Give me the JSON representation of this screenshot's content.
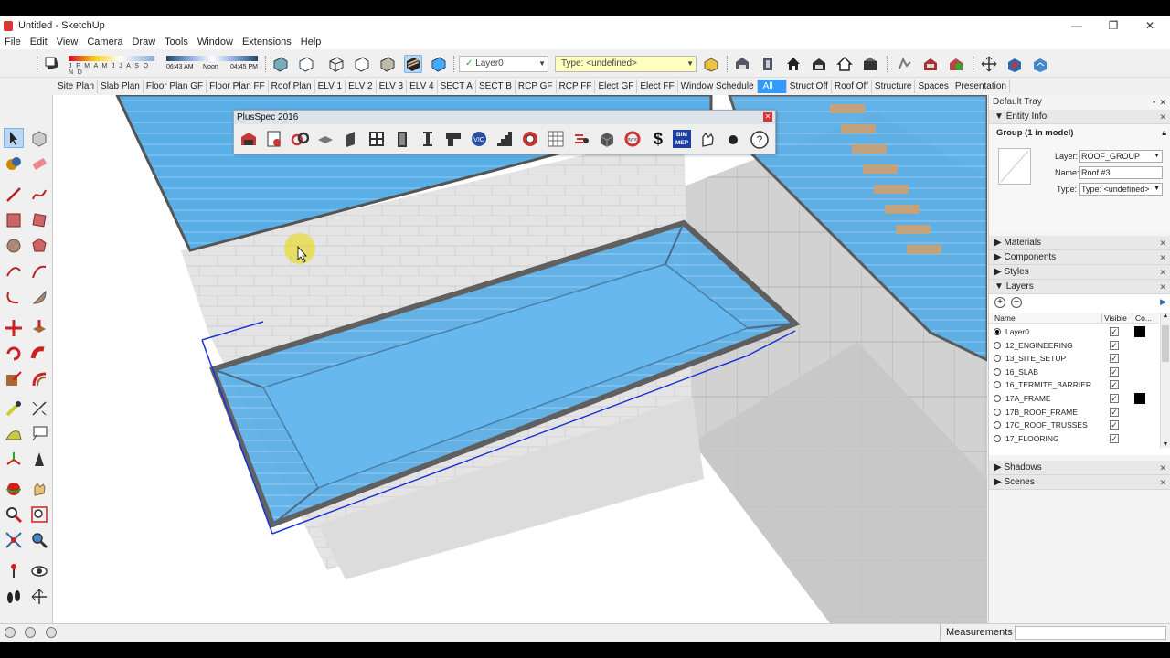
{
  "window": {
    "title": "Untitled - SketchUp",
    "minimize": "—",
    "restore": "❐",
    "close": "✕"
  },
  "menu": [
    "File",
    "Edit",
    "View",
    "Camera",
    "Draw",
    "Tools",
    "Window",
    "Extensions",
    "Help"
  ],
  "shadow_strip": {
    "months": "J F M A M J J A S O N D",
    "time_start": "06:43 AM",
    "time_mid": "Noon",
    "time_end": "04:45 PM"
  },
  "layer_dropdown": "Layer0",
  "type_dropdown": "Type: <undefined>",
  "scenes": [
    "Site Plan",
    "Slab Plan",
    "Floor Plan GF",
    "Floor Plan FF",
    "Roof Plan",
    "ELV 1",
    "ELV 2",
    "ELV 3",
    "ELV 4",
    "SECT A",
    "SECT B",
    "RCP GF",
    "RCP FF",
    "Elect GF",
    "Elect FF",
    "Window Schedule",
    "All",
    "Struct Off",
    "Roof Off",
    "Structure",
    "Spaces",
    "Presentation"
  ],
  "active_scene": "All",
  "plusspec": {
    "title": "PlusSpec 2016",
    "bim_label": "BIM MEP",
    "sync_label": "sync",
    "vic_label": "VIC"
  },
  "tray": {
    "title": "Default Tray",
    "entity_info": {
      "header": "Entity Info",
      "selection": "Group (1 in model)",
      "layer_label": "Layer:",
      "layer_value": "ROOF_GROUP",
      "name_label": "Name:",
      "name_value": "Roof #3",
      "type_label": "Type:",
      "type_value": "Type: <undefined>"
    },
    "sections": {
      "materials": "Materials",
      "components": "Components",
      "styles": "Styles",
      "layers": "Layers",
      "shadows": "Shadows",
      "scenes": "Scenes"
    },
    "layers": {
      "col_name": "Name",
      "col_visible": "Visible",
      "col_color": "Co...",
      "rows": [
        {
          "name": "Layer0",
          "active": true,
          "visible": true,
          "swatch": "#000000"
        },
        {
          "name": "12_ENGINEERING",
          "active": false,
          "visible": true,
          "swatch": ""
        },
        {
          "name": "13_SITE_SETUP",
          "active": false,
          "visible": true,
          "swatch": ""
        },
        {
          "name": "16_SLAB",
          "active": false,
          "visible": true,
          "swatch": ""
        },
        {
          "name": "16_TERMITE_BARRIER",
          "active": false,
          "visible": true,
          "swatch": ""
        },
        {
          "name": "17A_FRAME",
          "active": false,
          "visible": true,
          "swatch": "#000000"
        },
        {
          "name": "17B_ROOF_FRAME",
          "active": false,
          "visible": true,
          "swatch": ""
        },
        {
          "name": "17C_ROOF_TRUSSES",
          "active": false,
          "visible": true,
          "swatch": ""
        },
        {
          "name": "17_FLOORING",
          "active": false,
          "visible": true,
          "swatch": ""
        }
      ]
    }
  },
  "status": {
    "measurements_label": "Measurements",
    "measurements_value": ""
  },
  "colors": {
    "accent": "#3399ff",
    "roof_glass": "#4da6e8",
    "selection": "#1a33d6",
    "cursor_highlight": "#e8d800"
  }
}
